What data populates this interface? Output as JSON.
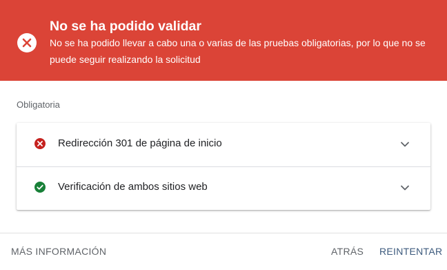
{
  "banner": {
    "title": "No se ha podido validar",
    "message": "No se ha podido llevar a cabo una o varias de las pruebas obligatorias, por lo que no se puede seguir realizando la solicitud",
    "icon": "error-circle-icon",
    "color": "#db4437"
  },
  "section": {
    "label": "Obligatoria"
  },
  "checks": [
    {
      "label": "Redirección 301 de página de inicio",
      "status": "error",
      "icon": "error-circle-icon",
      "color": "#c5221f"
    },
    {
      "label": "Verificación de ambos sitios web",
      "status": "success",
      "icon": "check-circle-icon",
      "color": "#188038"
    }
  ],
  "footer": {
    "more_info": "MÁS INFORMACIÓN",
    "back": "ATRÁS",
    "retry": "REINTENTAR"
  }
}
